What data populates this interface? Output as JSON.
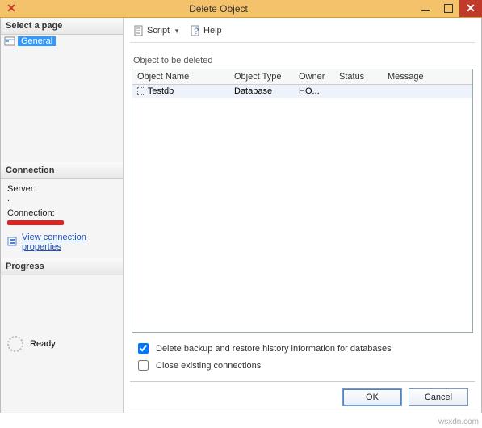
{
  "window": {
    "title": "Delete Object"
  },
  "sidebar": {
    "select_page_header": "Select a page",
    "pages": [
      {
        "label": "General"
      }
    ],
    "connection_header": "Connection",
    "server_label": "Server:",
    "server_value": ".",
    "connection_label": "Connection:",
    "view_conn_props": "View connection properties",
    "progress_header": "Progress",
    "progress_status": "Ready"
  },
  "toolbar": {
    "script_label": "Script",
    "help_label": "Help"
  },
  "main": {
    "section_label": "Object to be deleted",
    "columns": {
      "name": "Object Name",
      "type": "Object Type",
      "owner": "Owner",
      "status": "Status",
      "message": "Message"
    },
    "rows": [
      {
        "name": "Testdb",
        "type": "Database",
        "owner": "HO...",
        "status": "",
        "message": ""
      }
    ],
    "opt_delete_history": "Delete backup and restore history information for databases",
    "opt_close_existing": "Close existing connections"
  },
  "footer": {
    "ok": "OK",
    "cancel": "Cancel"
  },
  "watermark": "wsxdn.com"
}
